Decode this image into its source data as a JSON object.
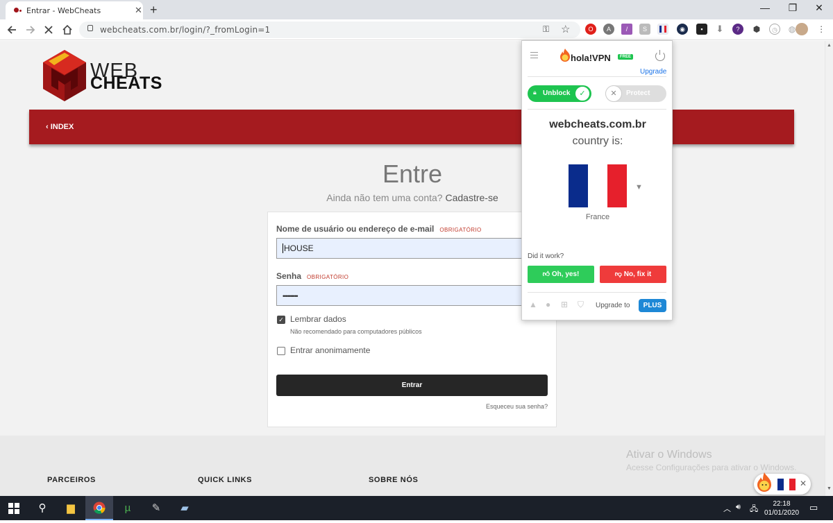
{
  "browser": {
    "tab_title": "Entrar - WebCheats",
    "tab_close": "✕",
    "new_tab": "+",
    "url": "webcheats.com.br/login/?_fromLogin=1",
    "window_controls": [
      "—",
      "❐",
      "✕"
    ]
  },
  "site": {
    "logo_word1": "WEB",
    "logo_word2": "CHEATS",
    "nav_index": "‹ INDEX",
    "title": "Entre",
    "subtitle_text": "Ainda não tem uma conta?",
    "subtitle_link": "Cadastre-se",
    "username_label": "Nome de usuário ou endereço de e-mail",
    "required_tag": "OBRIGATÓRIO",
    "username_value": "HOUSE",
    "password_label": "Senha",
    "password_value": "••••••••••",
    "remember_label": "Lembrar dados",
    "remember_hint": "Não recomendado para computadores públicos",
    "anonymous_label": "Entrar anonimamente",
    "submit_label": "Entrar",
    "forgot_label": "Esqueceu sua senha?",
    "footer_headings": [
      "PARCEIROS",
      "QUICK LINKS",
      "SOBRE NÓS"
    ],
    "watermark_title": "Ativar o Windows",
    "watermark_sub": "Acesse Configurações para ativar o Windows."
  },
  "hola": {
    "brand": "hola!VPN",
    "free_badge": "FREE",
    "upgrade": "Upgrade",
    "unblock": "Unblock",
    "protect": "Protect",
    "site": "webcheats.com.br",
    "country_is": "country is:",
    "country": "France",
    "did_it_work": "Did it work?",
    "yes": "Oh, yes!",
    "no": "No, fix it",
    "upgrade_to": "Upgrade to",
    "plus": "PLUS",
    "colors": {
      "green": "#1ec450",
      "red": "#ef3b3b",
      "blue": "#1e88d6"
    }
  },
  "taskbar": {
    "time": "22:18",
    "date": "01/01/2020"
  }
}
